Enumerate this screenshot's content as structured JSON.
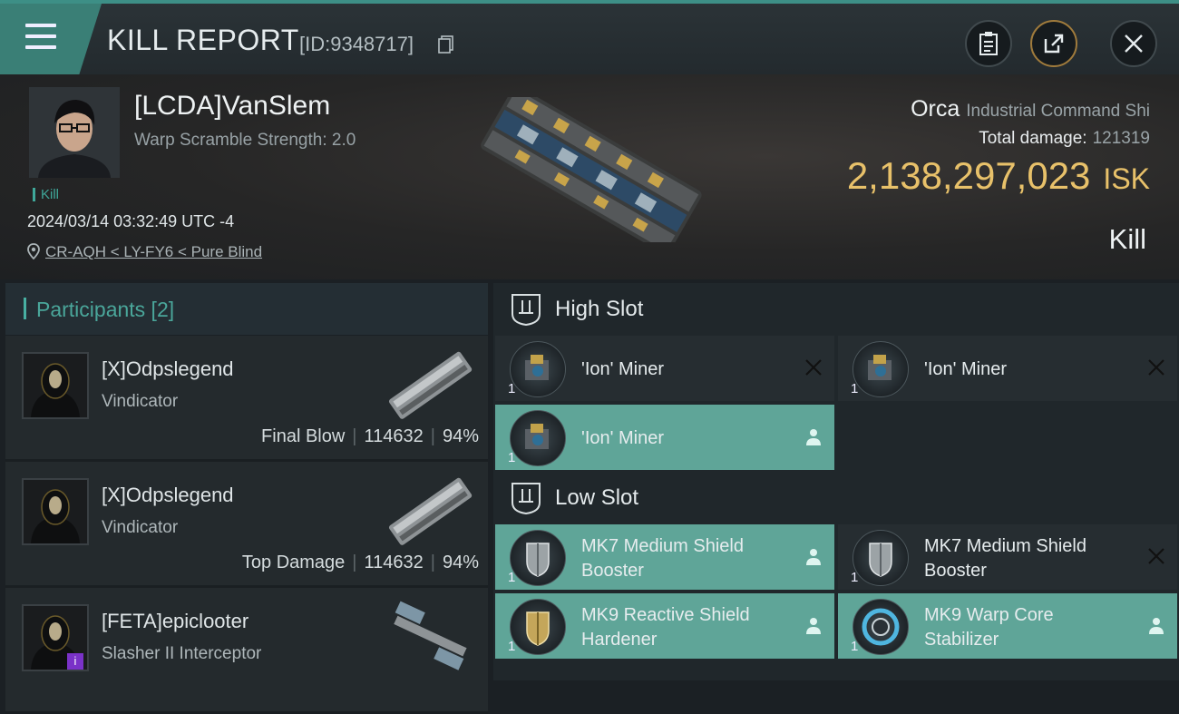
{
  "header": {
    "title": "KILL REPORT",
    "report_id": "[ID:9348717]"
  },
  "victim": {
    "name": "[LCDA]VanSlem",
    "warp_scramble": "Warp Scramble Strength: 2.0",
    "kill_tag": "Kill",
    "time": "2024/03/14 03:32:49 UTC -4",
    "location": "CR-AQH < LY-FY6 < Pure Blind",
    "ship": "Orca",
    "ship_class": "Industrial Command Shi",
    "total_damage_label": "Total damage:",
    "total_damage": "121319",
    "isk_value": "2,138,297,023",
    "isk_unit": "ISK",
    "result": "Kill"
  },
  "participants": {
    "label": "Participants [2]",
    "items": [
      {
        "name": "[X]Odpslegend",
        "ship": "Vindicator",
        "role": "Final Blow",
        "damage": "114632",
        "percent": "94%"
      },
      {
        "name": "[X]Odpslegend",
        "ship": "Vindicator",
        "role": "Top Damage",
        "damage": "114632",
        "percent": "94%"
      },
      {
        "name": "[FETA]epiclooter",
        "ship": "Slasher II Interceptor",
        "badge": "i"
      }
    ]
  },
  "slots": {
    "high_label": "High Slot",
    "low_label": "Low Slot",
    "high": [
      {
        "line1": "'Ion' Miner",
        "qty": "1",
        "status": "destroyed"
      },
      {
        "line1": "'Ion' Miner",
        "qty": "1",
        "status": "destroyed"
      },
      {
        "line1": "'Ion' Miner",
        "qty": "1",
        "status": "dropped"
      }
    ],
    "low": [
      {
        "line1": "MK7 Medium Shield",
        "line2": "Booster",
        "qty": "1",
        "status": "dropped"
      },
      {
        "line1": "MK7 Medium Shield",
        "line2": "Booster",
        "qty": "1",
        "status": "destroyed"
      },
      {
        "line1": "MK9 Reactive Shield",
        "line2": "Hardener",
        "qty": "1",
        "status": "dropped"
      },
      {
        "line1": "MK9 Warp Core",
        "line2": "Stabilizer",
        "qty": "1",
        "status": "dropped"
      }
    ]
  },
  "colors": {
    "accent": "#3a7f76",
    "dropped_highlight": "#5fa598",
    "isk": "#e8c16a",
    "participants_label": "#4aa69a"
  }
}
